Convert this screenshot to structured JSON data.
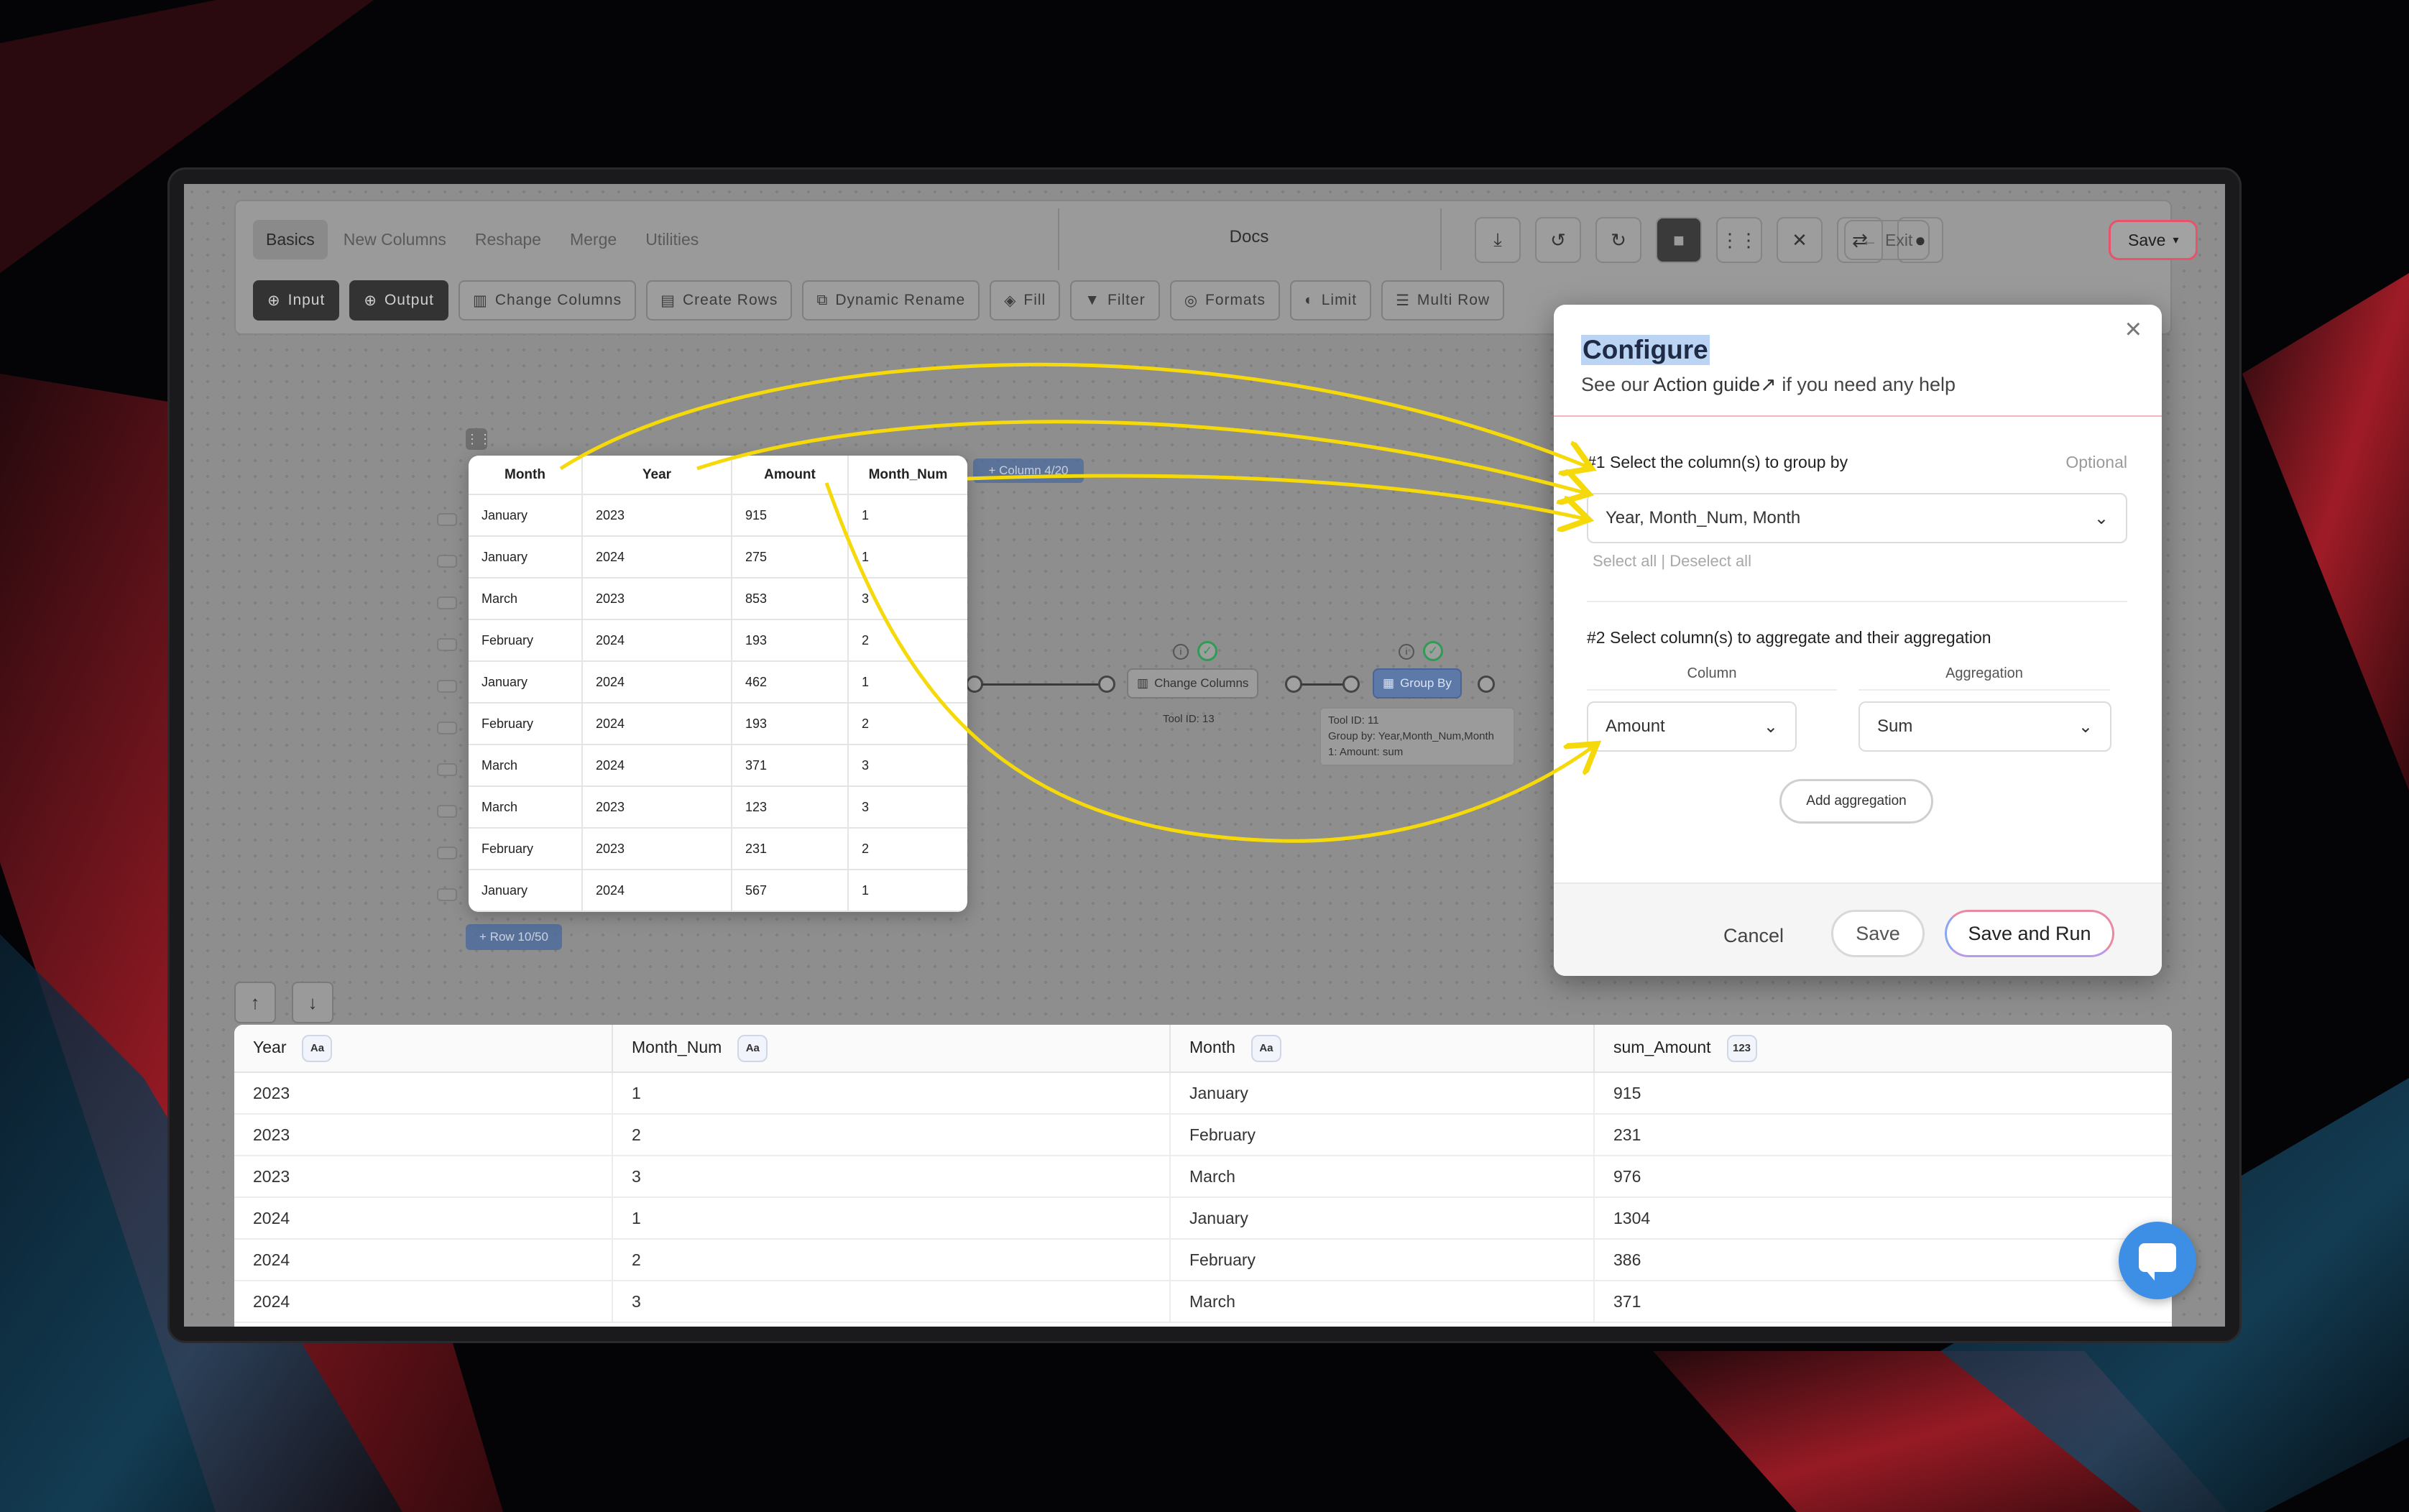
{
  "topbar": {
    "tabs": [
      "Basics",
      "New Columns",
      "Reshape",
      "Merge",
      "Utilities"
    ],
    "docs_label": "Docs",
    "exit_label": "Exit",
    "save_label": "Save"
  },
  "tools": [
    {
      "label": "Input",
      "icon": "plus-circle-icon"
    },
    {
      "label": "Output",
      "icon": "plus-circle-icon"
    },
    {
      "label": "Change Columns",
      "icon": "columns-icon"
    },
    {
      "label": "Create Rows",
      "icon": "rows-icon"
    },
    {
      "label": "Dynamic Rename",
      "icon": "rename-icon"
    },
    {
      "label": "Fill",
      "icon": "paint-bucket-icon"
    },
    {
      "label": "Filter",
      "icon": "funnel-icon"
    },
    {
      "label": "Formats",
      "icon": "fingerprint-icon"
    },
    {
      "label": "Limit",
      "icon": "half-circle-icon"
    },
    {
      "label": "Multi Row",
      "icon": "list-icon"
    }
  ],
  "preview_table": {
    "columns": [
      "Month",
      "Year",
      "Amount",
      "Month_Num"
    ],
    "rows": [
      [
        "January",
        "2023",
        "915",
        "1"
      ],
      [
        "January",
        "2024",
        "275",
        "1"
      ],
      [
        "March",
        "2023",
        "853",
        "3"
      ],
      [
        "February",
        "2024",
        "193",
        "2"
      ],
      [
        "January",
        "2024",
        "462",
        "1"
      ],
      [
        "February",
        "2024",
        "193",
        "2"
      ],
      [
        "March",
        "2024",
        "371",
        "3"
      ],
      [
        "March",
        "2023",
        "123",
        "3"
      ],
      [
        "February",
        "2023",
        "231",
        "2"
      ],
      [
        "January",
        "2024",
        "567",
        "1"
      ]
    ],
    "add_column_label": "+ Column 4/20",
    "add_row_label": "+ Row 10/50"
  },
  "flow": {
    "node1": {
      "label": "Change Columns",
      "note": "Tool ID: 13"
    },
    "node2": {
      "label": "Group By",
      "note_lines": [
        "Tool ID: 11",
        "Group by: Year,Month_Num,Month",
        "1: Amount: sum"
      ]
    }
  },
  "result_table": {
    "columns": [
      {
        "name": "Year",
        "type": "Aa"
      },
      {
        "name": "Month_Num",
        "type": "Aa"
      },
      {
        "name": "Month",
        "type": "Aa"
      },
      {
        "name": "sum_Amount",
        "type": "123"
      }
    ],
    "rows": [
      [
        "2023",
        "1",
        "January",
        "915"
      ],
      [
        "2023",
        "2",
        "February",
        "231"
      ],
      [
        "2023",
        "3",
        "March",
        "976"
      ],
      [
        "2024",
        "1",
        "January",
        "1304"
      ],
      [
        "2024",
        "2",
        "February",
        "386"
      ],
      [
        "2024",
        "3",
        "March",
        "371"
      ]
    ]
  },
  "modal": {
    "title": "Configure",
    "subtitle_prefix": "See our ",
    "subtitle_link": "Action guide↗",
    "subtitle_suffix": " if you need any help",
    "step1_label": "#1 Select the column(s) to group by",
    "step1_optional": "Optional",
    "step1_value": "Year, Month_Num, Month",
    "select_all": "Select all",
    "deselect_all": "Deselect all",
    "step2_label": "#2 Select column(s) to aggregate and their aggregation",
    "column_header": "Column",
    "aggregation_header": "Aggregation",
    "column_value": "Amount",
    "aggregation_value": "Sum",
    "add_aggregation": "Add aggregation",
    "cancel": "Cancel",
    "save": "Save",
    "save_and_run": "Save and Run"
  },
  "colors": {
    "accent_red": "#e6536a",
    "annotation_yellow": "#f5d90a",
    "node_blue": "#5d79a8",
    "chat_blue": "#3d8fe6"
  }
}
